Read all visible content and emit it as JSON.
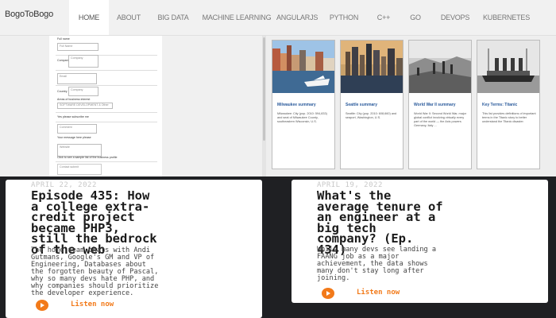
{
  "navbar": {
    "brand": "BogoToBogo",
    "items": [
      {
        "label": "HOME",
        "active": true
      },
      {
        "label": "ABOUT",
        "active": false
      },
      {
        "label": "BIG DATA",
        "active": false
      },
      {
        "label": "MACHINE LEARNING",
        "active": false
      },
      {
        "label": "ANGULARJS",
        "active": false
      },
      {
        "label": "PYTHON",
        "active": false
      },
      {
        "label": "C++",
        "active": false
      },
      {
        "label": "GO",
        "active": false
      },
      {
        "label": "DEVOPS",
        "active": false
      },
      {
        "label": "KUBERNETES",
        "active": false
      }
    ]
  },
  "form": {
    "name_label": "Full name",
    "name_value": "Full Name",
    "company_label": "Company",
    "company_value": "Company",
    "email_value": "Email",
    "country_label": "Country",
    "country_value": "Company",
    "select_label": "Areas of business interest",
    "select_value": "SOFTWARE DEVELOPMENT & Other",
    "checkbox_label": "Yes please subscribe me",
    "message_value": "Comment",
    "hint_text": "Your message here please",
    "website_value": "Website",
    "website_hint": "Click to see a sample list of the business profile",
    "submit_value": "Contact submit"
  },
  "cards": [
    {
      "title": "Milwaukee summary",
      "desc": "Milwaukee: City (pop. 2010: 594,833) and seat of Milwaukee County, southeastern Wisconsin, U.S."
    },
    {
      "title": "Seattle summary",
      "desc": "Seattle: City (pop. 2010: 608,660) and seaport, Washington, U.S."
    },
    {
      "title": "World War II summary",
      "desc": "World War II: Second World War, major global conflict involving virtually every part of the world — the Axis powers Germany, Italy ..."
    },
    {
      "title": "Key Terms: Titanic",
      "desc": "This list provides definitions of important terms in the Titanic story to better understand the Titanic disaster."
    }
  ],
  "podcasts": [
    {
      "date": "APRIL 22, 2022",
      "title_lines": [
        "Episode 435: How",
        "a college extra-",
        "credit project",
        "became PHP3,",
        "still the bedrock",
        "of the web"
      ],
      "desc_lines": [
        "The home team chats with Andi",
        "Gutmans, Google's GM and VP of",
        "Engineering, Databases about",
        "the forgotten beauty of Pascal,",
        "why so many devs hate PHP, and",
        "why companies should prioritize",
        "the developer experience."
      ],
      "listen": "Listen now"
    },
    {
      "date": "APRIL 19, 2022",
      "title_lines": [
        "What's the",
        "average tenure of",
        "an engineer at a",
        "big tech",
        "company? (Ep.",
        "434)"
      ],
      "desc_lines": [
        "While many devs see landing a",
        "FAANG job as a major",
        "achievement, the data shows",
        "many don't stay long after",
        "joining."
      ],
      "listen": "Listen now"
    }
  ],
  "colors": {
    "accent": "#f27a1a",
    "dark_bg": "#1f2023",
    "card_title": "#2a5a9b"
  }
}
